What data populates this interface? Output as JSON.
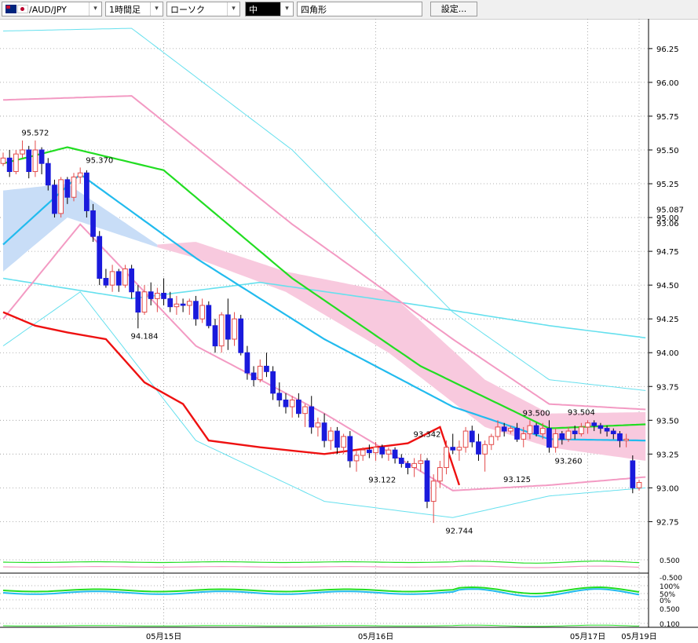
{
  "toolbar": {
    "symbol": "AUD/JPY",
    "timeframe": "1時間足",
    "chart_style": "ローソク",
    "size": "中",
    "drawing_tool": "四角形",
    "settings_label": "設定..."
  },
  "colors": {
    "up_candle": "#e34a4a",
    "down_candle": "#1a1adc",
    "bollinger_outer": "#66e0ee",
    "bollinger_inner": "#f39ac3",
    "sma_green": "#22dd22",
    "sma_blue": "#22bbee",
    "chikou_red": "#ee1111",
    "cloud_blue": "#c8ddf7",
    "cloud_pink": "#f8c9de"
  },
  "chart_data": {
    "type": "candlestick",
    "symbol": "AUD/JPY",
    "y_ticks": [
      "96.25",
      "96.00",
      "95.75",
      "95.50",
      "95.25",
      "95.00",
      "94.75",
      "94.50",
      "94.25",
      "94.00",
      "93.75",
      "93.50",
      "93.25",
      "93.00",
      "92.75"
    ],
    "y_range": [
      92.52,
      96.47
    ],
    "current_price_labels": [
      "95.087",
      "93.06"
    ],
    "x_labels": [
      {
        "label": "05月15日",
        "index": 25
      },
      {
        "label": "05月16日",
        "index": 58
      },
      {
        "label": "05月17日",
        "index": 91
      },
      {
        "label": "05月19日",
        "index": 99
      }
    ],
    "annotations": [
      {
        "text": "95.572",
        "index": 5,
        "value": 95.572,
        "pos": "above"
      },
      {
        "text": "95.370",
        "index": 15,
        "value": 95.37,
        "pos": "above"
      },
      {
        "text": "94.184",
        "index": 22,
        "value": 94.184,
        "pos": "below"
      },
      {
        "text": "93.342",
        "index": 66,
        "value": 93.342,
        "pos": "above"
      },
      {
        "text": "93.122",
        "index": 59,
        "value": 93.122,
        "pos": "below"
      },
      {
        "text": "92.744",
        "index": 71,
        "value": 92.744,
        "pos": "below"
      },
      {
        "text": "93.125",
        "index": 80,
        "value": 93.125,
        "pos": "below"
      },
      {
        "text": "93.500",
        "index": 83,
        "value": 93.5,
        "pos": "above"
      },
      {
        "text": "93.504",
        "index": 90,
        "value": 93.504,
        "pos": "above"
      },
      {
        "text": "93.260",
        "index": 88,
        "value": 93.26,
        "pos": "below"
      }
    ],
    "ohlc": [
      [
        95.4,
        95.48,
        95.38,
        95.44
      ],
      [
        95.44,
        95.5,
        95.3,
        95.34
      ],
      [
        95.34,
        95.5,
        95.32,
        95.47
      ],
      [
        95.47,
        95.57,
        95.44,
        95.5
      ],
      [
        95.5,
        95.53,
        95.29,
        95.34
      ],
      [
        95.34,
        95.57,
        95.3,
        95.5
      ],
      [
        95.5,
        95.52,
        95.32,
        95.4
      ],
      [
        95.4,
        95.44,
        95.2,
        95.24
      ],
      [
        95.24,
        95.28,
        95.0,
        95.03
      ],
      [
        95.03,
        95.3,
        95.0,
        95.28
      ],
      [
        95.28,
        95.3,
        95.1,
        95.15
      ],
      [
        95.15,
        95.33,
        95.12,
        95.3
      ],
      [
        95.3,
        95.37,
        95.25,
        95.33
      ],
      [
        95.33,
        95.35,
        95.0,
        95.05
      ],
      [
        95.05,
        95.1,
        94.82,
        94.86
      ],
      [
        94.86,
        94.9,
        94.5,
        94.55
      ],
      [
        94.55,
        94.62,
        94.48,
        94.5
      ],
      [
        94.5,
        94.65,
        94.45,
        94.6
      ],
      [
        94.6,
        94.62,
        94.45,
        94.5
      ],
      [
        94.5,
        94.65,
        94.48,
        94.62
      ],
      [
        94.62,
        94.65,
        94.4,
        94.45
      ],
      [
        94.45,
        94.5,
        94.18,
        94.3
      ],
      [
        94.3,
        94.5,
        94.28,
        94.45
      ],
      [
        94.45,
        94.52,
        94.35,
        94.4
      ],
      [
        94.4,
        94.48,
        94.3,
        94.44
      ],
      [
        94.44,
        94.55,
        94.35,
        94.4
      ],
      [
        94.4,
        94.45,
        94.3,
        94.34
      ],
      [
        94.34,
        94.42,
        94.28,
        94.36
      ],
      [
        94.36,
        94.4,
        94.3,
        94.35
      ],
      [
        94.35,
        94.4,
        94.28,
        94.38
      ],
      [
        94.38,
        94.42,
        94.2,
        94.25
      ],
      [
        94.25,
        94.4,
        94.22,
        94.35
      ],
      [
        94.35,
        94.38,
        94.18,
        94.2
      ],
      [
        94.2,
        94.25,
        94.0,
        94.05
      ],
      [
        94.05,
        94.3,
        94.0,
        94.28
      ],
      [
        94.28,
        94.4,
        94.02,
        94.1
      ],
      [
        94.1,
        94.3,
        94.05,
        94.25
      ],
      [
        94.25,
        94.28,
        93.98,
        94.0
      ],
      [
        94.0,
        94.05,
        93.8,
        93.85
      ],
      [
        93.85,
        93.9,
        93.75,
        93.8
      ],
      [
        93.8,
        93.95,
        93.78,
        93.9
      ],
      [
        93.9,
        94.0,
        93.82,
        93.86
      ],
      [
        93.86,
        93.9,
        93.65,
        93.7
      ],
      [
        93.7,
        93.78,
        93.6,
        93.65
      ],
      [
        93.65,
        93.7,
        93.55,
        93.6
      ],
      [
        93.6,
        93.68,
        93.52,
        93.65
      ],
      [
        93.65,
        93.7,
        93.52,
        93.55
      ],
      [
        93.55,
        93.62,
        93.45,
        93.6
      ],
      [
        93.6,
        93.68,
        93.4,
        93.45
      ],
      [
        93.45,
        93.52,
        93.38,
        93.48
      ],
      [
        93.48,
        93.55,
        93.3,
        93.35
      ],
      [
        93.35,
        93.45,
        93.28,
        93.42
      ],
      [
        93.42,
        93.45,
        93.25,
        93.3
      ],
      [
        93.3,
        93.4,
        93.25,
        93.38
      ],
      [
        93.38,
        93.42,
        93.15,
        93.2
      ],
      [
        93.2,
        93.28,
        93.12,
        93.24
      ],
      [
        93.24,
        93.3,
        93.2,
        93.28
      ],
      [
        93.28,
        93.32,
        93.22,
        93.26
      ],
      [
        93.26,
        93.34,
        93.2,
        93.3
      ],
      [
        93.3,
        93.32,
        93.22,
        93.25
      ],
      [
        93.25,
        93.3,
        93.2,
        93.28
      ],
      [
        93.28,
        93.3,
        93.18,
        93.22
      ],
      [
        93.22,
        93.25,
        93.15,
        93.18
      ],
      [
        93.18,
        93.2,
        93.1,
        93.15
      ],
      [
        93.15,
        93.22,
        93.08,
        93.18
      ],
      [
        93.18,
        93.25,
        93.12,
        93.2
      ],
      [
        93.2,
        93.22,
        92.85,
        92.9
      ],
      [
        92.9,
        93.1,
        92.74,
        93.05
      ],
      [
        93.05,
        93.2,
        93.0,
        93.15
      ],
      [
        93.15,
        93.35,
        93.1,
        93.3
      ],
      [
        93.3,
        93.4,
        93.25,
        93.28
      ],
      [
        93.28,
        93.35,
        93.2,
        93.3
      ],
      [
        93.3,
        93.45,
        93.26,
        93.42
      ],
      [
        93.42,
        93.46,
        93.3,
        93.34
      ],
      [
        93.34,
        93.4,
        93.2,
        93.25
      ],
      [
        93.25,
        93.35,
        93.12,
        93.32
      ],
      [
        93.32,
        93.4,
        93.28,
        93.38
      ],
      [
        93.38,
        93.5,
        93.35,
        93.45
      ],
      [
        93.45,
        93.48,
        93.38,
        93.42
      ],
      [
        93.42,
        93.46,
        93.4,
        93.44
      ],
      [
        93.44,
        93.48,
        93.34,
        93.36
      ],
      [
        93.36,
        93.45,
        93.3,
        93.4
      ],
      [
        93.4,
        93.5,
        93.36,
        93.46
      ],
      [
        93.46,
        93.48,
        93.38,
        93.4
      ],
      [
        93.4,
        93.48,
        93.36,
        93.44
      ],
      [
        93.44,
        93.5,
        93.26,
        93.3
      ],
      [
        93.3,
        93.44,
        93.26,
        93.4
      ],
      [
        93.4,
        93.42,
        93.32,
        93.36
      ],
      [
        93.36,
        93.45,
        93.34,
        93.42
      ],
      [
        93.42,
        93.46,
        93.36,
        93.4
      ],
      [
        93.4,
        93.48,
        93.38,
        93.45
      ],
      [
        93.45,
        93.5,
        93.4,
        93.48
      ],
      [
        93.48,
        93.5,
        93.42,
        93.46
      ],
      [
        93.46,
        93.48,
        93.4,
        93.44
      ],
      [
        93.44,
        93.46,
        93.38,
        93.42
      ],
      [
        93.42,
        93.44,
        93.36,
        93.4
      ],
      [
        93.4,
        93.42,
        93.3,
        93.35
      ],
      [
        93.35,
        93.4,
        93.3,
        93.36
      ],
      [
        93.2,
        93.24,
        92.96,
        93.0
      ],
      [
        93.0,
        93.06,
        92.98,
        93.04
      ]
    ],
    "lines": {
      "bb_upper2": [
        [
          0,
          96.38
        ],
        [
          20,
          96.4
        ],
        [
          45,
          95.5
        ],
        [
          70,
          94.3
        ],
        [
          85,
          93.8
        ],
        [
          100,
          93.72
        ]
      ],
      "bb_upper1": [
        [
          0,
          95.87
        ],
        [
          20,
          95.9
        ],
        [
          45,
          94.95
        ],
        [
          70,
          94.1
        ],
        [
          85,
          93.62
        ],
        [
          100,
          93.58
        ]
      ],
      "sma_green": [
        [
          0,
          95.4
        ],
        [
          10,
          95.52
        ],
        [
          25,
          95.35
        ],
        [
          45,
          94.55
        ],
        [
          65,
          93.9
        ],
        [
          85,
          93.44
        ],
        [
          100,
          93.47
        ]
      ],
      "sma_blue": [
        [
          0,
          94.8
        ],
        [
          12,
          95.32
        ],
        [
          30,
          94.7
        ],
        [
          50,
          94.1
        ],
        [
          70,
          93.6
        ],
        [
          85,
          93.36
        ],
        [
          100,
          93.35
        ]
      ],
      "bb_lower1": [
        [
          0,
          94.25
        ],
        [
          12,
          94.95
        ],
        [
          30,
          94.05
        ],
        [
          50,
          93.55
        ],
        [
          70,
          92.98
        ],
        [
          85,
          93.02
        ],
        [
          100,
          93.08
        ]
      ],
      "bb_lower2": [
        [
          0,
          94.05
        ],
        [
          12,
          94.45
        ],
        [
          30,
          93.35
        ],
        [
          50,
          92.9
        ],
        [
          70,
          92.78
        ],
        [
          85,
          92.94
        ],
        [
          100,
          93.0
        ]
      ],
      "lagging_line": [
        [
          0,
          94.3
        ],
        [
          5,
          94.2
        ],
        [
          10,
          94.15
        ],
        [
          16,
          94.1
        ],
        [
          22,
          93.78
        ],
        [
          28,
          93.62
        ],
        [
          32,
          93.35
        ],
        [
          40,
          93.3
        ],
        [
          50,
          93.25
        ],
        [
          58,
          93.3
        ],
        [
          63,
          93.33
        ],
        [
          68,
          93.45
        ],
        [
          71,
          93.02
        ]
      ],
      "bottom_line": [
        [
          0,
          94.55
        ],
        [
          20,
          94.4
        ],
        [
          40,
          94.52
        ],
        [
          65,
          94.35
        ],
        [
          85,
          94.2
        ],
        [
          100,
          94.11
        ]
      ]
    },
    "oscillator_labels": [
      "0.500",
      "-0.500",
      "100%",
      "50%",
      "0%",
      "0.500",
      "0.100"
    ]
  }
}
